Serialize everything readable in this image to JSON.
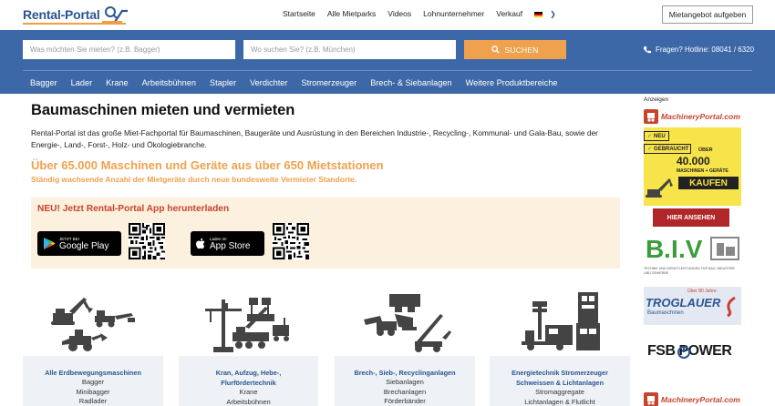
{
  "header": {
    "logo": {
      "text": "Rental-Portal"
    },
    "nav": [
      "Startseite",
      "Alle Mietparks",
      "Videos",
      "Lohnunternehmer",
      "Verkauf"
    ],
    "cta_label": "Mietangebot aufgeben"
  },
  "search": {
    "what_placeholder": "Was möchten Sie mieten? (z.B. Bagger)",
    "where_placeholder": "Wo suchen Sie? (z.B. München)",
    "button_label": "SUCHEN",
    "hotline": "Fragen? Hotline: 08041 / 6320"
  },
  "categories": [
    "Bagger",
    "Lader",
    "Krane",
    "Arbeitsbühnen",
    "Stapler",
    "Verdichter",
    "Stromerzeuger",
    "Brech- & Siebanlagen",
    "Weitere Produktbereiche"
  ],
  "main": {
    "title": "Baumaschinen mieten und vermieten",
    "intro": "Rental-Portal ist das große Miet-Fachportal für Baumaschinen, Baugeräte und Ausrüstung in den Bereichen Industrie-, Recycling-, Kommunal- und Gala-Bau, sowie der Energie-, Land-, Forst-, Holz- und Ökologiebranche.",
    "headline": "Über 65.000 Maschinen und Geräte aus über 650 Mietstationen",
    "subheadline": "Ständig wachsende Anzahl der Mietgeräte durch neue bundesweite Vermieter Standorte.",
    "app": {
      "title": "NEU! Jetzt Rental-Portal App herunterladen",
      "google_small": "JETZT BEI",
      "google_big": "Google Play",
      "apple_small": "Laden im",
      "apple_big": "App Store"
    }
  },
  "cards": [
    {
      "title_lines": [
        "Alle Erdbewegungsmaschinen"
      ],
      "items": [
        "Bagger",
        "Minibagger",
        "Radlader"
      ]
    },
    {
      "title_lines": [
        "Kran, Aufzug, Hebe-,",
        "Flurfördertechnik"
      ],
      "items": [
        "Krane",
        "Arbeitsbühnen"
      ]
    },
    {
      "title_lines": [
        "Brech-, Sieb-, Recyclinganlagen"
      ],
      "items": [
        "Siebanlagen",
        "Brechanlagen",
        "Förderbänder"
      ]
    },
    {
      "title_lines": [
        "Energietechnik Stromerzeuger",
        "Schweissen & Lichtanlagen"
      ],
      "items": [
        "Stromaggregate",
        "Lichtanlagen & Flutlicht"
      ]
    }
  ],
  "ads": {
    "label": "Anzeigen",
    "machinery_portal": "MachineryPortal.com",
    "badge_new": "NEU",
    "badge_used": "GEBRAUCHT",
    "offer_over": "ÜBER",
    "offer_count": "40.000",
    "offer_text": "MASCHINEN + GERÄTE",
    "offer_buy": "KAUFEN",
    "offer_button": "HIER ANSEHEN",
    "biv_name": "BIV",
    "biv_sub": "TECHNIK UND DIENSTLEISTUNGEN FÜR BAU, INDUSTRIE UND GEWERBE",
    "troglauer": "TROGLAUER",
    "troglauer_sub": "Baumaschinen",
    "troglauer_years": "Über 80 Jahre",
    "fsb": "FSB POWER",
    "machinery_portal_2": "MachineryPortal.com"
  },
  "colors": {
    "brand_blue": "#3d68a8",
    "accent_orange": "#f0a14d",
    "app_red": "#c8432b"
  }
}
